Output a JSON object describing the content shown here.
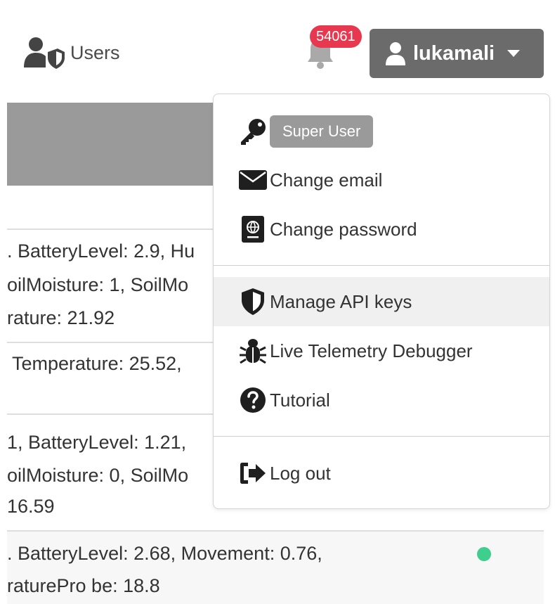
{
  "navbar": {
    "users_label": "Users",
    "notification_count": "54061",
    "username": "lukamali"
  },
  "background_table": {
    "rows": [
      {
        "lines": [
          ". BatteryLevel: 2.9, Hu",
          "oilMoisture: 1, SoilMo",
          "rature: 21.92"
        ]
      },
      {
        "lines": [
          " Temperature: 25.52,"
        ]
      },
      {
        "lines": [
          "1, BatteryLevel: 1.21,",
          "oilMoisture: 0, SoilMo",
          "16.59"
        ]
      },
      {
        "lines": [
          ". BatteryLevel: 2.68, Movement: 0.76,",
          "raturePro be: 18.8"
        ]
      }
    ]
  },
  "user_menu": {
    "role_badge": "Super User",
    "items": [
      {
        "label": "Change email",
        "icon": "envelope-icon"
      },
      {
        "label": "Change password",
        "icon": "passport-icon"
      },
      {
        "label": "Manage API keys",
        "icon": "shield-icon"
      },
      {
        "label": "Live Telemetry Debugger",
        "icon": "bug-icon"
      },
      {
        "label": "Tutorial",
        "icon": "question-circle-icon"
      },
      {
        "label": "Log out",
        "icon": "sign-out-icon"
      }
    ]
  },
  "colors": {
    "user_button": "#6b6b6b",
    "badge": "#e8384f",
    "status_online": "#3ecf8e",
    "header_grey": "#9a9a9a"
  }
}
